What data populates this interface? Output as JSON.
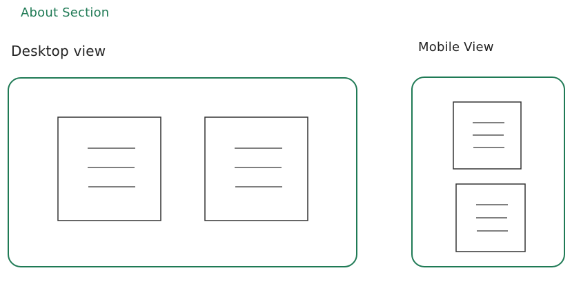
{
  "title": "About Section",
  "views": {
    "desktop_label": "Desktop view",
    "mobile_label": "Mobile View"
  },
  "colors": {
    "accent": "#1f7a55",
    "stroke": "#333333"
  }
}
